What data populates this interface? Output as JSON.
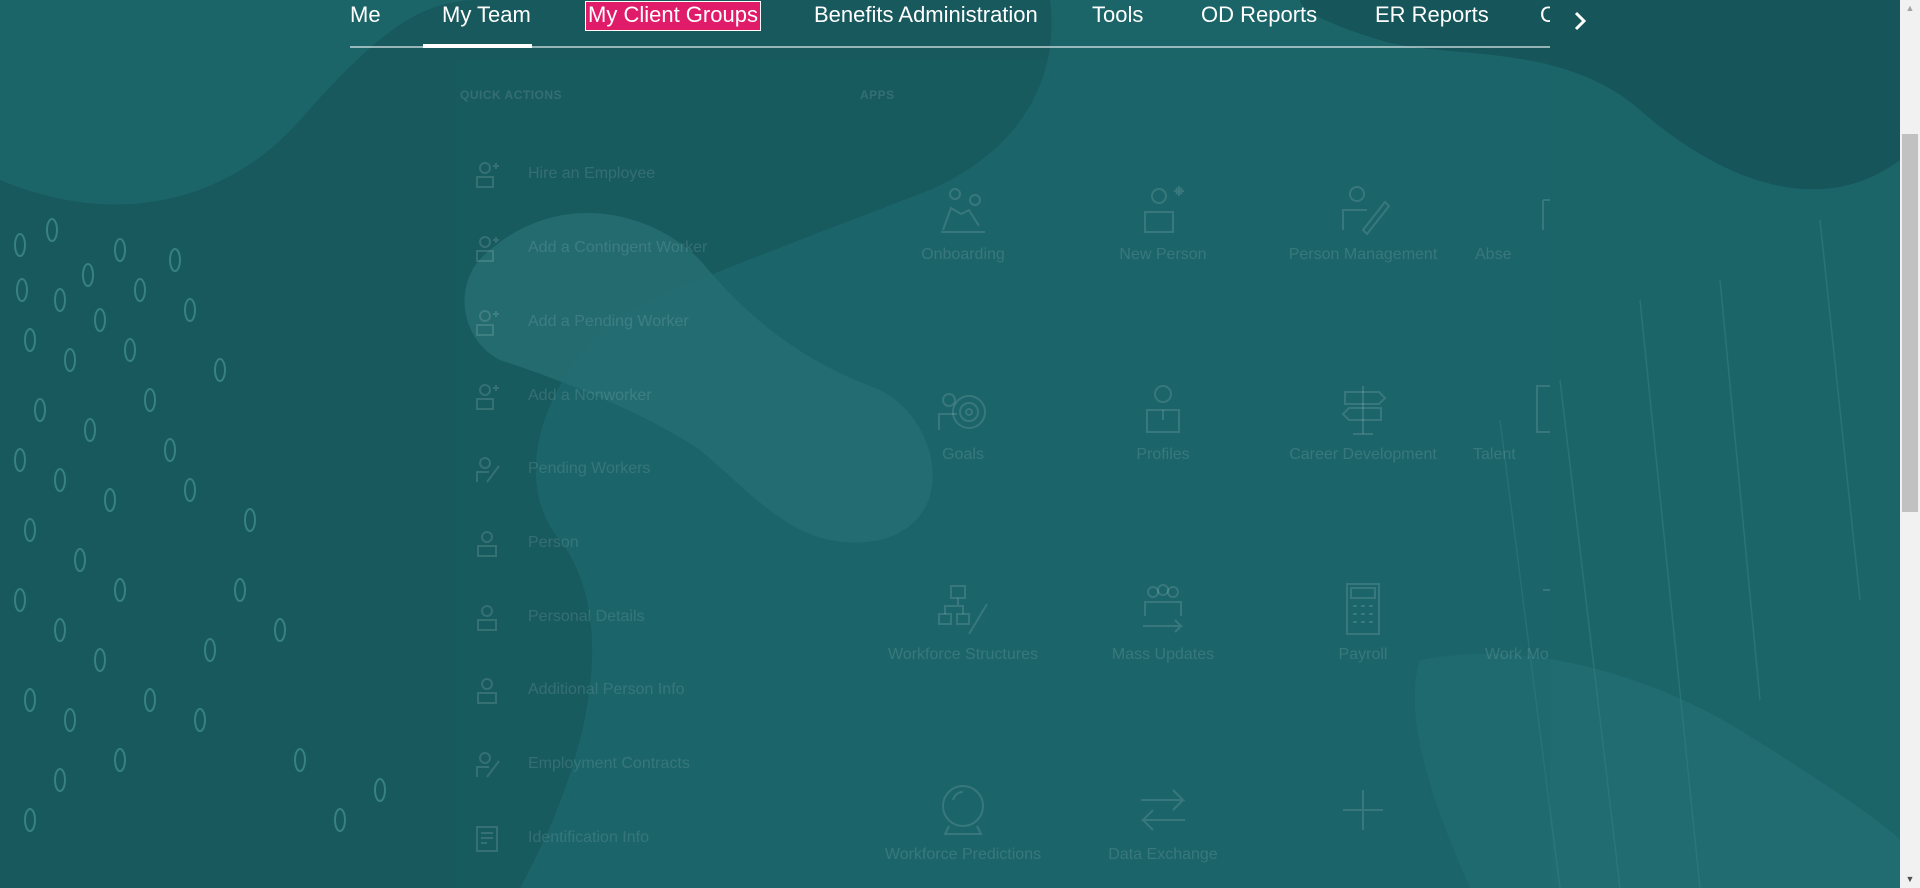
{
  "nav": {
    "tabs": [
      {
        "label": "Me"
      },
      {
        "label": "My Team"
      },
      {
        "label": "My Client Groups"
      },
      {
        "label": "Benefits Administration"
      },
      {
        "label": "Tools"
      },
      {
        "label": "OD Reports"
      },
      {
        "label": "ER Reports"
      },
      {
        "label": "C"
      }
    ],
    "active_tab": "My Team",
    "focused_tab": "My Client Groups",
    "next_icon": "chevron-right-icon"
  },
  "quick_actions": {
    "title": "QUICK ACTIONS",
    "items": [
      {
        "label": "Hire an Employee",
        "icon": "add-person-icon"
      },
      {
        "label": "Add a Contingent Worker",
        "icon": "add-person-icon"
      },
      {
        "label": "Add a Pending Worker",
        "icon": "add-person-icon"
      },
      {
        "label": "Add a Nonworker",
        "icon": "add-person-icon"
      },
      {
        "label": "Pending Workers",
        "icon": "person-edit-icon"
      },
      {
        "label": "Person",
        "icon": "person-icon"
      },
      {
        "label": "Personal Details",
        "icon": "person-icon"
      },
      {
        "label": "Additional Person Info",
        "icon": "person-icon"
      },
      {
        "label": "Employment Contracts",
        "icon": "person-edit-icon"
      },
      {
        "label": "Identification Info",
        "icon": "id-card-icon"
      }
    ]
  },
  "apps": {
    "title": "APPS",
    "items": [
      {
        "label": "Onboarding",
        "icon": "onboarding-icon"
      },
      {
        "label": "New Person",
        "icon": "new-person-icon"
      },
      {
        "label": "Person Management",
        "icon": "person-management-icon"
      },
      {
        "label": "Abse",
        "icon": "absence-icon"
      },
      {
        "label": "Goals",
        "icon": "goals-icon"
      },
      {
        "label": "Profiles",
        "icon": "profiles-icon"
      },
      {
        "label": "Career Development",
        "icon": "signpost-icon"
      },
      {
        "label": "Talent",
        "icon": "talent-icon"
      },
      {
        "label": "Workforce Structures",
        "icon": "org-chart-icon"
      },
      {
        "label": "Mass Updates",
        "icon": "mass-updates-icon"
      },
      {
        "label": "Payroll",
        "icon": "calculator-icon"
      },
      {
        "label": "Work Mo",
        "icon": "workforce-modeling-icon"
      },
      {
        "label": "Workforce Predictions",
        "icon": "crystal-ball-icon"
      },
      {
        "label": "Data Exchange",
        "icon": "exchange-icon"
      },
      {
        "label": "",
        "icon": "plus-icon"
      }
    ]
  },
  "colors": {
    "background": "#1b6569",
    "focus_highlight": "#e01b6a",
    "text": "#ffffff"
  }
}
